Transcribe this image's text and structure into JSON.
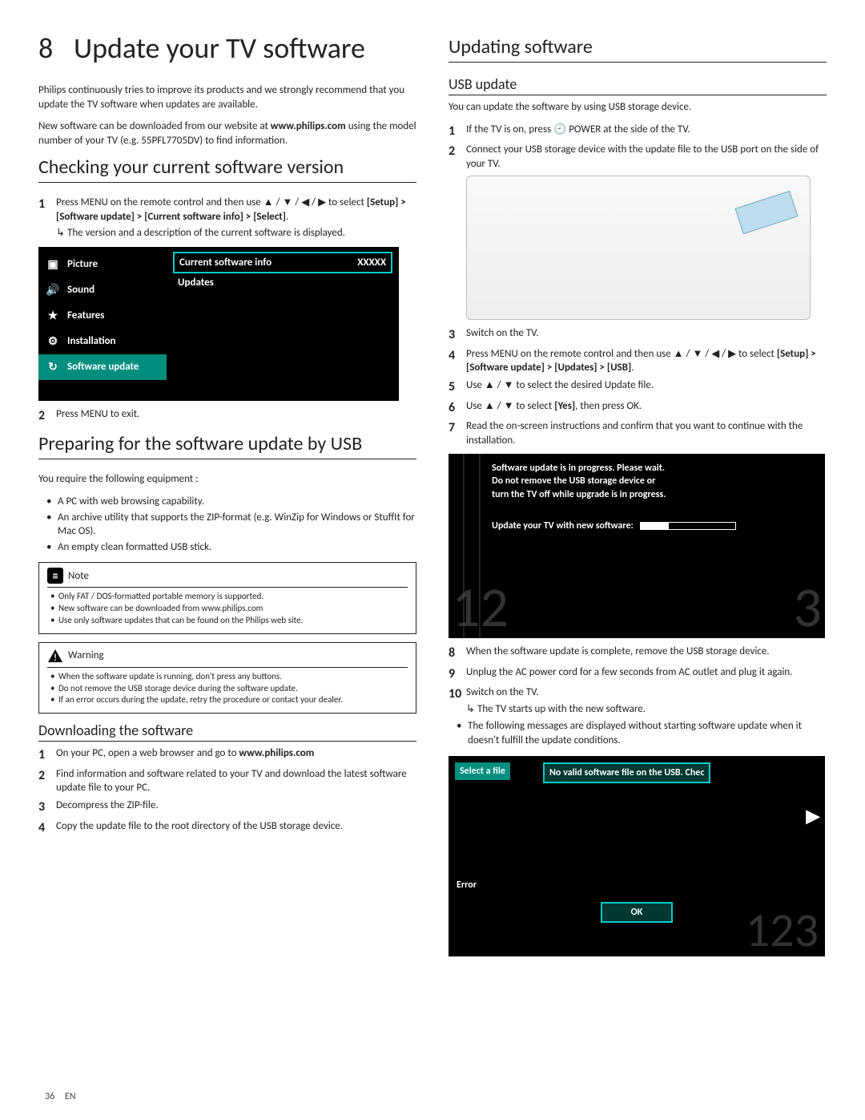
{
  "page": {
    "chapter_num": "8",
    "title": "Update your TV software",
    "page_number": "36",
    "lang": "EN"
  },
  "intro": {
    "p1": "Philips continuously tries to improve its products and we strongly recommend that you update the TV software when updates are available.",
    "p2_pre": "New software can be downloaded from our website at ",
    "p2_site": "www.philips.com",
    "p2_post": " using the model number of your TV (e.g. 55PFL7705DV) to find information."
  },
  "checking": {
    "heading": "Checking your current software version",
    "step1_a": "Press MENU on the remote control and then use ▲ / ▼ / ◀ / ▶ to select ",
    "step1_path": "[Setup] > [Software update] > [Current software info] > [Select]",
    "step1_dot": ".",
    "step1_sub": "The version and a description of the current software is displayed.",
    "step2": "Press MENU to exit."
  },
  "tvmenu": {
    "items": [
      {
        "icon": "▣",
        "label": "Picture"
      },
      {
        "icon": "🔊",
        "label": "Sound"
      },
      {
        "icon": "★",
        "label": "Features"
      },
      {
        "icon": "⚙",
        "label": "Installation"
      },
      {
        "icon": "↻",
        "label": "Software update"
      }
    ],
    "selected_index": 4,
    "right": [
      {
        "label": "Current software info",
        "value": "XXXXX",
        "selected": true
      },
      {
        "label": "Updates",
        "value": "",
        "selected": false
      }
    ]
  },
  "preparing": {
    "heading": "Preparing for the software update by USB",
    "intro": "You require the following equipment :",
    "bullets": [
      "A PC with web browsing capability.",
      "An archive utility that supports the ZIP-format (e.g. WinZip for Windows or StuffIt for Mac OS).",
      "An empty clean formatted USB stick."
    ]
  },
  "note": {
    "title": "Note",
    "items": [
      "Only FAT / DOS-formatted portable memory is supported.",
      "New software can be downloaded from www.philips.com",
      "Use only software updates that can be found on the Philips web site."
    ]
  },
  "warning": {
    "title": "Warning",
    "items": [
      "When the software update is running, don't press any buttons.",
      "Do not remove the USB storage device during the software update.",
      "If an error occurs during the update, retry the procedure or contact your dealer."
    ]
  },
  "downloading": {
    "heading": "Downloading the software",
    "s1_pre": "On your PC, open a web browser and go to ",
    "s1_site": "www.philips.com",
    "s2": "Find information and software related to your TV and download the latest software update file to your PC.",
    "s3": "Decompress the ZIP-file.",
    "s4": "Copy the update file to the root directory of the USB storage device."
  },
  "updating": {
    "heading": "Updating software",
    "sub": "USB update",
    "intro": "You can update the software by using USB storage device.",
    "s1": "If the TV is on, press 🕘 POWER at the side of the TV.",
    "s2": "Connect your USB storage device with the update file to the USB port on the side of your TV.",
    "s3": "Switch on the TV.",
    "s4_a": "Press MENU on the remote control and then use ▲ / ▼ / ◀ / ▶ to select ",
    "s4_path": "[Setup] > [Software update] > [Updates] > [USB]",
    "s4_dot": ".",
    "s5": "Use ▲ / ▼ to select the desired Update file.",
    "s6_a": "Use ▲ / ▼ to select ",
    "s6_key": "[Yes]",
    "s6_b": ", then press OK.",
    "s7": "Read the on-screen instructions and confirm that you want to continue with the installation."
  },
  "progress": {
    "msg_l1": "Software update is in progress. Please wait.",
    "msg_l2": "Do not remove the USB storage device or",
    "msg_l3": "turn the TV off while upgrade is in progress.",
    "bar_label": "Update your TV with new software:",
    "wm_left": "12",
    "wm_right": "3"
  },
  "after": {
    "s8": "When the software update is complete, remove the USB storage device.",
    "s9": "Unplug the AC power cord for a few seconds from AC outlet and plug it again.",
    "s10": "Switch on the TV.",
    "s10_sub": "The TV starts up with the new software.",
    "tail": "The following messages are displayed without starting software update when it doesn't fulfill the update conditions."
  },
  "error": {
    "side_label": "Select a file",
    "msg": "No valid software file on the USB. Chec",
    "error_label": "Error",
    "ok": "OK",
    "wm": "123"
  }
}
